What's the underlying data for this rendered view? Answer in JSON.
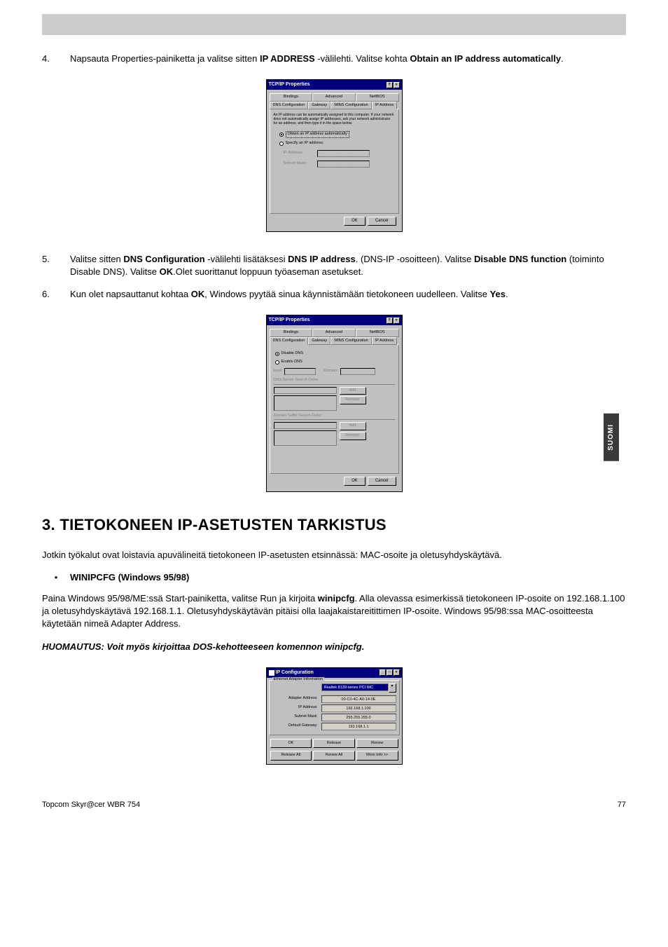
{
  "side_tab": "SUOMI",
  "top_bar": "",
  "step4": {
    "num": "4.",
    "text_pre": "Napsauta Properties-painiketta ja valitse sitten ",
    "bold1": "IP ADDRESS",
    "text_mid": " -välilehti. Valitse kohta ",
    "bold2": "Obtain an IP address automatically",
    "text_end": "."
  },
  "dialog1": {
    "title": "TCP/IP Properties",
    "help_btn": "?",
    "close_btn": "×",
    "tabs_row1": {
      "t1": "Bindings",
      "t2": "Advanced",
      "t3": "NetBIOS"
    },
    "tabs_row2": {
      "t1": "DNS Configuration",
      "t2": "Gateway",
      "t3": "WINS Configuration",
      "t4": "IP Address"
    },
    "panel_text": "An IP address can be automatically assigned to this computer. If your network does not automatically assign IP addresses, ask your network administrator for an address, and then type it in the space below.",
    "radio1": "Obtain an IP address automatically",
    "radio2": "Specify an IP address:",
    "ip_label": "IP Address:",
    "subnet_label": "Subnet Mask:",
    "ok": "OK",
    "cancel": "Cancel"
  },
  "step5": {
    "num": "5.",
    "t1": "Valitse sitten ",
    "b1": "DNS Configuration",
    "t2": " -välilehti lisätäksesi ",
    "b2": "DNS IP address",
    "t3": ". (DNS-IP -osoitteen). Valitse ",
    "b3": "Disable DNS function",
    "t4": " (toiminto Disable DNS). Valitse ",
    "b4": "OK",
    "t5": ".Olet suorittanut loppuun työaseman asetukset."
  },
  "step6": {
    "num": "6.",
    "t1": "Kun olet napsauttanut kohtaa ",
    "b1": "OK",
    "t2": ", Windows pyytää sinua käynnistämään tietokoneen uudelleen. Valitse ",
    "b2": "Yes",
    "t3": "."
  },
  "dialog2": {
    "title": "TCP/IP Properties",
    "help_btn": "?",
    "close_btn": "×",
    "tabs_row1": {
      "t1": "Bindings",
      "t2": "Advanced",
      "t3": "NetBIOS"
    },
    "tabs_row2": {
      "t1": "DNS Configuration",
      "t2": "Gateway",
      "t3": "WINS Configuration",
      "t4": "IP Address"
    },
    "radio1": "Disable DNS",
    "radio2": "Enable DNS",
    "host_lbl": "Host:",
    "domain_lbl": "Domain:",
    "search_lbl": "DNS Server Search Order",
    "suffix_lbl": "Domain Suffix Search Order",
    "add": "Add",
    "remove": "Remove",
    "ok": "OK",
    "cancel": "Cancel"
  },
  "section3": {
    "heading": "3. TIETOKONEEN IP-ASETUSTEN TARKISTUS",
    "intro": "Jotkin työkalut ovat loistavia apuvälineitä tietokoneen IP-asetusten etsinnässä: MAC-osoite ja oletusyhdyskäytävä.",
    "bullet_label": "WINIPCFG (Windows 95/98)",
    "para_t1": "Paina Windows 95/98/ME:ssä Start-painiketta, valitse Run ja kirjoita ",
    "para_b1": "winipcfg",
    "para_t2": ". Alla olevassa esimerkissä tietokoneen IP-osoite on 192.168.1.100 ja oletusyhdyskäytävä 192.168.1.1. Oletusyhdyskäytävän pitäisi olla laajakaistareitittimen IP-osoite. Windows 95/98:ssa MAC-osoitteesta käytetään nimeä Adapter Address.",
    "note": "HUOMAUTUS: Voit myös kirjoittaa DOS-kehotteeseen komennon winipcfg."
  },
  "ipconfig": {
    "title": "IP Configuration",
    "min_btn": "_",
    "max_btn": "□",
    "close_btn": "×",
    "group_label": "Ethernet Adapter Information",
    "dropdown": "Realtek 8139-series PCI NIC",
    "rows": {
      "adapter_lbl": "Adapter Address",
      "adapter_val": "00-C0-4C-A0-14-0E",
      "ip_lbl": "IP Address",
      "ip_val": "192.168.1.100",
      "subnet_lbl": "Subnet Mask",
      "subnet_val": "255.255.255.0",
      "gateway_lbl": "Default Gateway",
      "gateway_val": "192.168.1.1"
    },
    "btns": {
      "ok": "OK",
      "release": "Release",
      "renew": "Renew",
      "release_all": "Release All",
      "renew_all": "Renew All",
      "more": "More Info >>"
    }
  },
  "footer": {
    "left": "Topcom Skyr@cer WBR 754",
    "right": "77"
  }
}
